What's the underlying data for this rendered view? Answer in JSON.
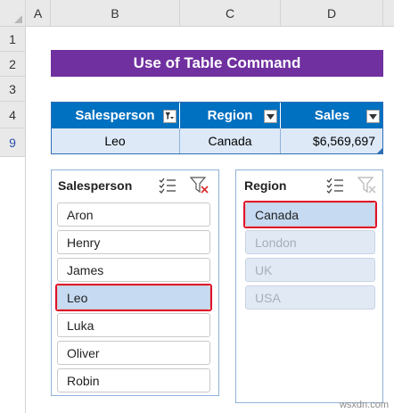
{
  "columns": [
    "A",
    "B",
    "C",
    "D"
  ],
  "rows": [
    "1",
    "2",
    "3",
    "4",
    "9"
  ],
  "title": "Use of Table Command",
  "table": {
    "headers": [
      "Salesperson",
      "Region",
      "Sales"
    ],
    "row": {
      "salesperson": "Leo",
      "region": "Canada",
      "sales": "$6,569,697"
    }
  },
  "slicer_salesperson": {
    "title": "Salesperson",
    "items": [
      "Aron",
      "Henry",
      "James",
      "Leo",
      "Luka",
      "Oliver",
      "Robin"
    ],
    "selected": "Leo"
  },
  "slicer_region": {
    "title": "Region",
    "items": [
      "Canada",
      "London",
      "UK",
      "USA"
    ],
    "selected": "Canada"
  },
  "watermark": "wsxdn.com",
  "icons": {
    "multi_select": "multi-select-icon",
    "clear_filter": "clear-filter-icon",
    "table_filter_active": "filter-active-icon",
    "table_dropdown": "dropdown-arrow-icon"
  },
  "colors": {
    "title_bg": "#7030a0",
    "header_bg": "#0070c0",
    "row_bg": "#dde9f7",
    "selected_item": "#c6daf1",
    "highlight": "#e0102b"
  }
}
